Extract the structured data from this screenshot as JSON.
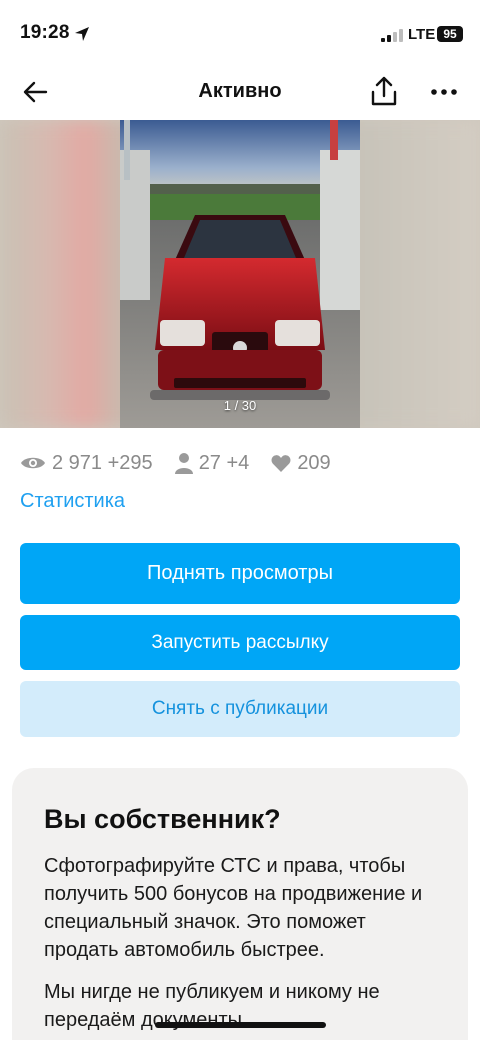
{
  "status_bar": {
    "time": "19:28",
    "network": "LTE",
    "battery": "95"
  },
  "nav": {
    "title": "Активно",
    "icons": [
      "arrow-left-icon",
      "share-icon",
      "more-icon"
    ]
  },
  "gallery": {
    "counter": "1 / 30",
    "current_index": 1,
    "total": 30
  },
  "stats": {
    "views": "2 971",
    "views_delta": "+295",
    "contacts": "27",
    "contacts_delta": "+4",
    "favorites": "209",
    "link_label": "Статистика"
  },
  "actions": {
    "raise_views": "Поднять просмотры",
    "start_mailing": "Запустить рассылку",
    "unpublish": "Снять с публикации"
  },
  "owner_card": {
    "title": "Вы собственник?",
    "text": "Сфотографируйте СТС и права, чтобы получить 500 бонусов на продвижение и специальный значок. Это поможет продать автомобиль быстрее.",
    "note": "Мы нигде не публикуем и никому не передаём документы"
  },
  "colors": {
    "primary": "#00a6f6",
    "secondary_bg": "#d3ecfb",
    "link": "#1fa0f0",
    "muted": "#8a8a8a"
  }
}
